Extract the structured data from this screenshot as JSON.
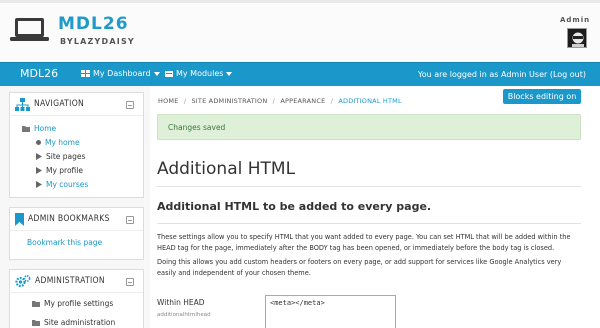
{
  "header": {
    "site_title": "MDL26",
    "site_subtitle": "BYLAZYDAISY",
    "user_name": "Admin"
  },
  "navbar": {
    "brand": "MDL26",
    "dashboard": "My Dashboard",
    "modules": "My Modules",
    "logged_in": "You are logged in as Admin User (Log out)"
  },
  "navigation": {
    "title": "NAVIGATION",
    "home": "Home",
    "items": [
      "My home",
      "Site pages",
      "My profile",
      "My courses"
    ]
  },
  "bookmarks": {
    "title": "ADMIN BOOKMARKS",
    "link": "Bookmark this page"
  },
  "administration": {
    "title": "ADMINISTRATION",
    "items": [
      "My profile settings",
      "Site administration"
    ]
  },
  "breadcrumb": {
    "home": "HOME",
    "site_admin": "SITE ADMINISTRATION",
    "appearance": "APPEARANCE",
    "current": "ADDITIONAL HTML",
    "sep": "/"
  },
  "blocks_editing": "Blocks editing on",
  "alert": "Changes saved",
  "page_title": "Additional HTML",
  "section_title": "Additional HTML to be added to every page.",
  "description": {
    "p1": "These settings allow you to specify HTML that you want added to every page. You can set HTML that will be added within the HEAD tag for the page, immediately after the BODY tag has been opened, or immediately before the body tag is closed.",
    "p2": "Doing this allows you add custom headers or footers on every page, or add support for services like Google Analytics very easily and independent of your chosen theme."
  },
  "field": {
    "label": "Within HEAD",
    "name": "additionalhtmlhead",
    "value": "<meta></meta>"
  },
  "colors": {
    "accent": "#1b98ca",
    "alert_bg": "#dff0d8",
    "alert_text": "#3c763d"
  }
}
